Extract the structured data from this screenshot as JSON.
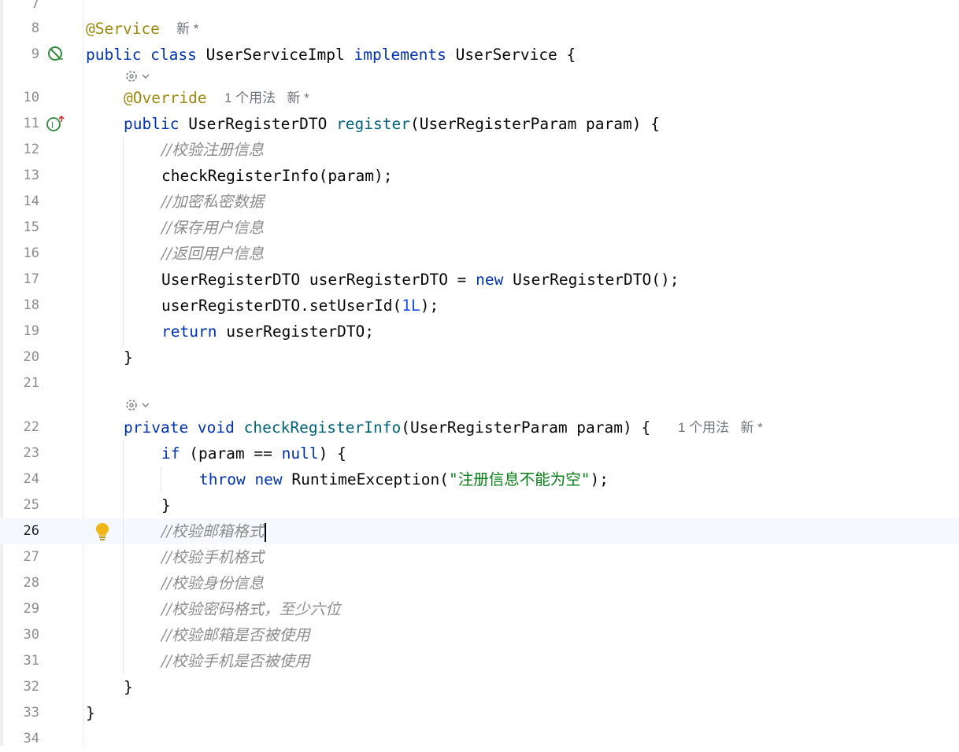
{
  "editor": {
    "current_line": "26",
    "lines": [
      {
        "num": "7"
      },
      {
        "num": "8",
        "annotation": "@Service",
        "hint": "新 *"
      },
      {
        "num": "9",
        "kw1": "public class",
        "cls": "UserServiceImpl",
        "kw2": "implements",
        "iface": "UserService {"
      },
      {
        "hint_icon": "gear-chevron"
      },
      {
        "num": "10",
        "annotation": "@Override",
        "hint": "1 个用法   新 *"
      },
      {
        "num": "11",
        "kw": "public",
        "type": "UserRegisterDTO",
        "method": "register",
        "params": "(UserRegisterParam param) {"
      },
      {
        "num": "12",
        "comment": "//校验注册信息"
      },
      {
        "num": "13",
        "text": "checkRegisterInfo(param);"
      },
      {
        "num": "14",
        "comment": "//加密私密数据"
      },
      {
        "num": "15",
        "comment": "//保存用户信息"
      },
      {
        "num": "16",
        "comment": "//返回用户信息"
      },
      {
        "num": "17",
        "text_a": "UserRegisterDTO userRegisterDTO = ",
        "kw": "new",
        "text_b": " UserRegisterDTO();"
      },
      {
        "num": "18",
        "text_a": "userRegisterDTO.setUserId(",
        "lit": "1L",
        "text_b": ");"
      },
      {
        "num": "19",
        "kw": "return",
        "text": " userRegisterDTO;"
      },
      {
        "num": "20",
        "text": "}"
      },
      {
        "num": "21"
      },
      {
        "hint_icon": "gear-chevron"
      },
      {
        "num": "22",
        "kw": "private void",
        "method": "checkRegisterInfo",
        "params": "(UserRegisterParam param) {",
        "hint": "1 个用法   新 *"
      },
      {
        "num": "23",
        "kw_a": "if",
        "text_a": " (param == ",
        "kw_b": "null",
        "text_b": ") {"
      },
      {
        "num": "24",
        "kw": "throw new",
        "text_a": " RuntimeException(",
        "str": "\"注册信息不能为空\"",
        "text_b": ");"
      },
      {
        "num": "25",
        "text": "}"
      },
      {
        "num": "26",
        "comment": "//校验邮箱格式"
      },
      {
        "num": "27",
        "comment": "//校验手机格式"
      },
      {
        "num": "28",
        "comment": "//校验身份信息"
      },
      {
        "num": "29",
        "comment": "//校验密码格式，至少六位"
      },
      {
        "num": "30",
        "comment": "//校验邮箱是否被使用"
      },
      {
        "num": "31",
        "comment": "//校验手机是否被使用"
      },
      {
        "num": "32",
        "text": "}"
      },
      {
        "num": "33",
        "text": "}"
      },
      {
        "num": "34"
      }
    ]
  },
  "colors": {
    "keyword": "#0033b3",
    "annotation": "#9e880d",
    "method": "#00627a",
    "number": "#1750eb",
    "string": "#067d17",
    "comment": "#8c8c8c",
    "hint": "#6f737a"
  },
  "icons": {
    "line9": "no-entry-icon",
    "line11": "implements-interface-icon",
    "line26": "lightbulb-icon"
  }
}
